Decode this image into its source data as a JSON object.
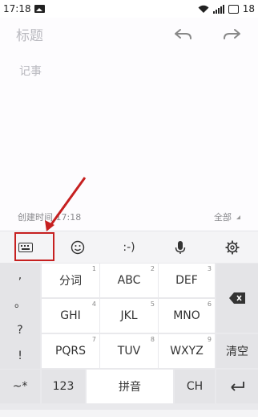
{
  "status_bar": {
    "time": "17:18",
    "battery": "18"
  },
  "note": {
    "title_placeholder": "标题",
    "body_placeholder": "记事",
    "created_label": "创建时间 17:18",
    "category": "全部"
  },
  "toolbar": {
    "items": [
      "keyboard-icon",
      "emoji-icon",
      ":-)",
      "mic-icon",
      "gear-icon"
    ],
    "emoticon": ":-)"
  },
  "keyboard": {
    "punctuation": [
      ",",
      "。",
      "?",
      "!"
    ],
    "rows": [
      [
        {
          "label": "分词",
          "num": "1"
        },
        {
          "label": "ABC",
          "num": "2"
        },
        {
          "label": "DEF",
          "num": "3"
        }
      ],
      [
        {
          "label": "GHI",
          "num": "4"
        },
        {
          "label": "JKL",
          "num": "5"
        },
        {
          "label": "MNO",
          "num": "6"
        }
      ],
      [
        {
          "label": "PQRS",
          "num": "7"
        },
        {
          "label": "TUV",
          "num": "8"
        },
        {
          "label": "WXYZ",
          "num": "9"
        }
      ]
    ],
    "clear": "清空",
    "bottom": {
      "symbols": "~*",
      "numbers": "123",
      "pinyin": "拼音",
      "lang": "CH"
    }
  },
  "colors": {
    "highlight": "#c62020",
    "background": "#fdfcfe"
  }
}
